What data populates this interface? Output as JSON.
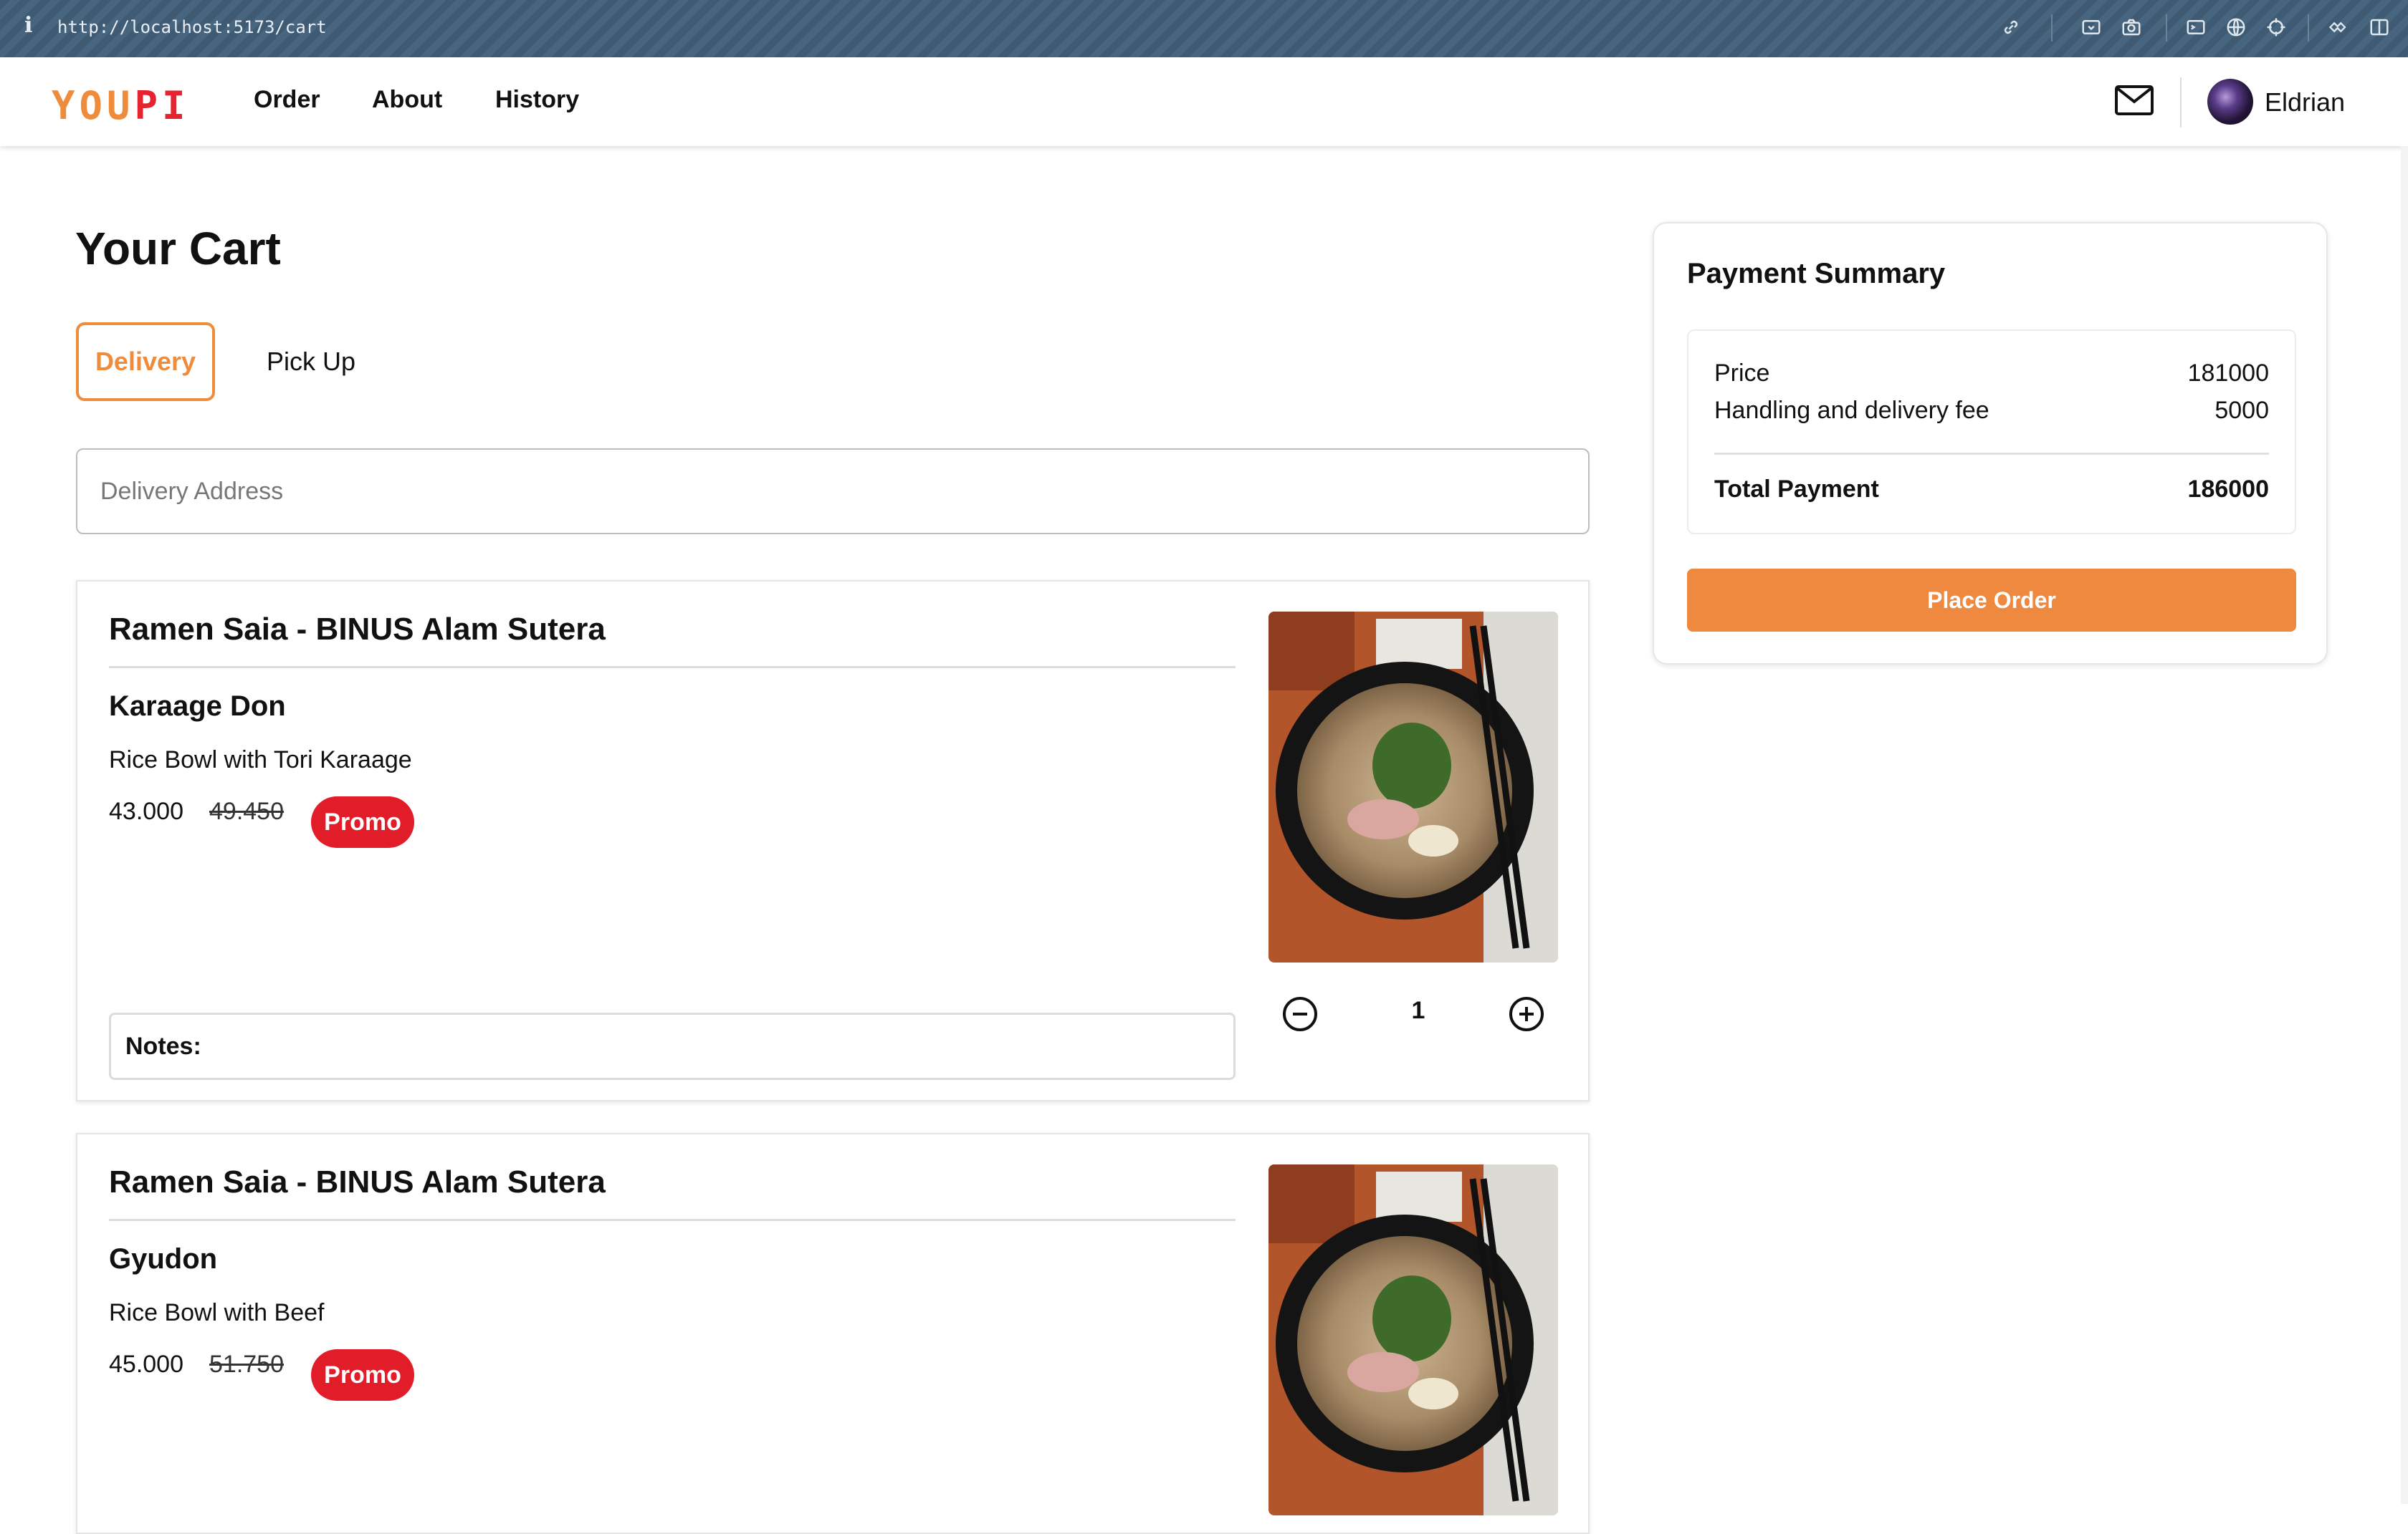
{
  "browser": {
    "info_glyph": "i",
    "url": "http://localhost:5173/cart"
  },
  "header": {
    "logo": {
      "part1": "YOU",
      "part2": "PI"
    },
    "nav": [
      {
        "label": "Order"
      },
      {
        "label": "About"
      },
      {
        "label": "History"
      }
    ],
    "mail_icon": "envelope-icon",
    "user": {
      "name": "Eldrian"
    }
  },
  "cart": {
    "title": "Your Cart",
    "tabs": {
      "delivery": "Delivery",
      "pickup": "Pick Up",
      "selected": "Delivery"
    },
    "address": {
      "placeholder": "Delivery Address",
      "value": ""
    },
    "items": [
      {
        "store": "Ramen Saia - BINUS Alam Sutera",
        "name": "Karaage Don",
        "description": "Rice Bowl with Tori Karaage",
        "price": "43.000",
        "original_price": "49.450",
        "badge": "Promo",
        "notes_label": "Notes:",
        "quantity": "1"
      },
      {
        "store": "Ramen Saia - BINUS Alam Sutera",
        "name": "Gyudon",
        "description": "Rice Bowl with Beef",
        "price": "45.000",
        "original_price": "51.750",
        "badge": "Promo"
      }
    ]
  },
  "summary": {
    "title": "Payment Summary",
    "price_label": "Price",
    "price_value": "181000",
    "fee_label": "Handling and delivery fee",
    "fee_value": "5000",
    "total_label": "Total Payment",
    "total_value": "186000",
    "button": "Place Order"
  },
  "colors": {
    "accent": "#ef8c3c",
    "promo": "#e21d2a",
    "logo_red": "#e52331"
  }
}
